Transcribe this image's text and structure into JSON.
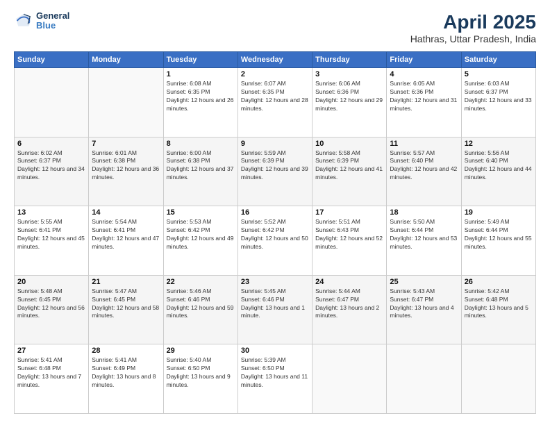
{
  "logo": {
    "line1": "General",
    "line2": "Blue"
  },
  "title": "April 2025",
  "subtitle": "Hathras, Uttar Pradesh, India",
  "weekdays": [
    "Sunday",
    "Monday",
    "Tuesday",
    "Wednesday",
    "Thursday",
    "Friday",
    "Saturday"
  ],
  "weeks": [
    [
      {
        "day": "",
        "info": ""
      },
      {
        "day": "",
        "info": ""
      },
      {
        "day": "1",
        "info": "Sunrise: 6:08 AM\nSunset: 6:35 PM\nDaylight: 12 hours and 26 minutes."
      },
      {
        "day": "2",
        "info": "Sunrise: 6:07 AM\nSunset: 6:35 PM\nDaylight: 12 hours and 28 minutes."
      },
      {
        "day": "3",
        "info": "Sunrise: 6:06 AM\nSunset: 6:36 PM\nDaylight: 12 hours and 29 minutes."
      },
      {
        "day": "4",
        "info": "Sunrise: 6:05 AM\nSunset: 6:36 PM\nDaylight: 12 hours and 31 minutes."
      },
      {
        "day": "5",
        "info": "Sunrise: 6:03 AM\nSunset: 6:37 PM\nDaylight: 12 hours and 33 minutes."
      }
    ],
    [
      {
        "day": "6",
        "info": "Sunrise: 6:02 AM\nSunset: 6:37 PM\nDaylight: 12 hours and 34 minutes."
      },
      {
        "day": "7",
        "info": "Sunrise: 6:01 AM\nSunset: 6:38 PM\nDaylight: 12 hours and 36 minutes."
      },
      {
        "day": "8",
        "info": "Sunrise: 6:00 AM\nSunset: 6:38 PM\nDaylight: 12 hours and 37 minutes."
      },
      {
        "day": "9",
        "info": "Sunrise: 5:59 AM\nSunset: 6:39 PM\nDaylight: 12 hours and 39 minutes."
      },
      {
        "day": "10",
        "info": "Sunrise: 5:58 AM\nSunset: 6:39 PM\nDaylight: 12 hours and 41 minutes."
      },
      {
        "day": "11",
        "info": "Sunrise: 5:57 AM\nSunset: 6:40 PM\nDaylight: 12 hours and 42 minutes."
      },
      {
        "day": "12",
        "info": "Sunrise: 5:56 AM\nSunset: 6:40 PM\nDaylight: 12 hours and 44 minutes."
      }
    ],
    [
      {
        "day": "13",
        "info": "Sunrise: 5:55 AM\nSunset: 6:41 PM\nDaylight: 12 hours and 45 minutes."
      },
      {
        "day": "14",
        "info": "Sunrise: 5:54 AM\nSunset: 6:41 PM\nDaylight: 12 hours and 47 minutes."
      },
      {
        "day": "15",
        "info": "Sunrise: 5:53 AM\nSunset: 6:42 PM\nDaylight: 12 hours and 49 minutes."
      },
      {
        "day": "16",
        "info": "Sunrise: 5:52 AM\nSunset: 6:42 PM\nDaylight: 12 hours and 50 minutes."
      },
      {
        "day": "17",
        "info": "Sunrise: 5:51 AM\nSunset: 6:43 PM\nDaylight: 12 hours and 52 minutes."
      },
      {
        "day": "18",
        "info": "Sunrise: 5:50 AM\nSunset: 6:44 PM\nDaylight: 12 hours and 53 minutes."
      },
      {
        "day": "19",
        "info": "Sunrise: 5:49 AM\nSunset: 6:44 PM\nDaylight: 12 hours and 55 minutes."
      }
    ],
    [
      {
        "day": "20",
        "info": "Sunrise: 5:48 AM\nSunset: 6:45 PM\nDaylight: 12 hours and 56 minutes."
      },
      {
        "day": "21",
        "info": "Sunrise: 5:47 AM\nSunset: 6:45 PM\nDaylight: 12 hours and 58 minutes."
      },
      {
        "day": "22",
        "info": "Sunrise: 5:46 AM\nSunset: 6:46 PM\nDaylight: 12 hours and 59 minutes."
      },
      {
        "day": "23",
        "info": "Sunrise: 5:45 AM\nSunset: 6:46 PM\nDaylight: 13 hours and 1 minute."
      },
      {
        "day": "24",
        "info": "Sunrise: 5:44 AM\nSunset: 6:47 PM\nDaylight: 13 hours and 2 minutes."
      },
      {
        "day": "25",
        "info": "Sunrise: 5:43 AM\nSunset: 6:47 PM\nDaylight: 13 hours and 4 minutes."
      },
      {
        "day": "26",
        "info": "Sunrise: 5:42 AM\nSunset: 6:48 PM\nDaylight: 13 hours and 5 minutes."
      }
    ],
    [
      {
        "day": "27",
        "info": "Sunrise: 5:41 AM\nSunset: 6:48 PM\nDaylight: 13 hours and 7 minutes."
      },
      {
        "day": "28",
        "info": "Sunrise: 5:41 AM\nSunset: 6:49 PM\nDaylight: 13 hours and 8 minutes."
      },
      {
        "day": "29",
        "info": "Sunrise: 5:40 AM\nSunset: 6:50 PM\nDaylight: 13 hours and 9 minutes."
      },
      {
        "day": "30",
        "info": "Sunrise: 5:39 AM\nSunset: 6:50 PM\nDaylight: 13 hours and 11 minutes."
      },
      {
        "day": "",
        "info": ""
      },
      {
        "day": "",
        "info": ""
      },
      {
        "day": "",
        "info": ""
      }
    ]
  ]
}
